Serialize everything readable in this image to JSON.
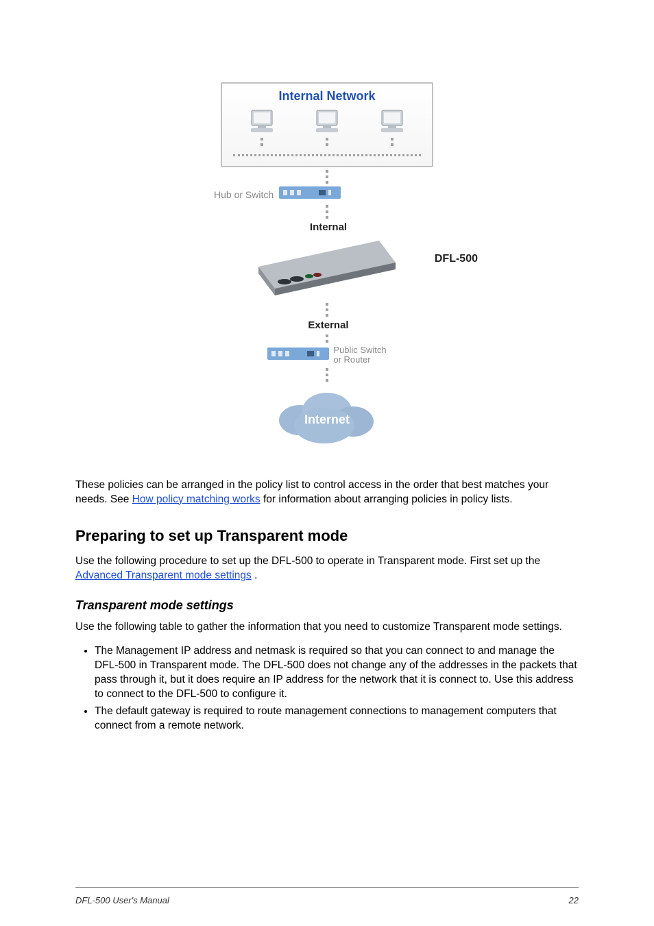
{
  "diagram": {
    "internal_network_title": "Internal Network",
    "hub_label": "Hub or Switch",
    "internal_port_label": "Internal",
    "device_model": "DFL-500",
    "external_port_label": "External",
    "public_switch_label_line1": "Public Switch",
    "public_switch_label_line2": "or Router",
    "cloud_label": "Internet"
  },
  "body": {
    "para1_part1": "These policies can be arranged in the policy list to control access in the order that best matches your needs. See ",
    "para1_link": "How policy matching works",
    "para1_part2": " for information about arranging policies in policy lists."
  },
  "section1": {
    "heading": "Preparing to set up Transparent mode",
    "para1_part1": "Use the following procedure to set up the DFL-500 to operate in Transparent mode. First set up the ",
    "para1_link": "Advanced Transparent mode settings",
    "para1_part2": ".",
    "subheading": "Transparent mode settings",
    "para2": "Use the following table to gather the information that you need to customize Transparent mode settings.",
    "bullets": [
      "The Management IP address and netmask is required so that you can connect to and manage the DFL-500 in Transparent mode. The DFL-500 does not change any of the addresses in the packets that pass through it, but it does require an IP address for the network that it is connect to. Use this address to connect to the DFL-500 to configure it.",
      "The default gateway is required to route management connections to management computers that connect from a remote network."
    ]
  },
  "footer": {
    "left": "DFL-500 User's Manual",
    "right": "22"
  }
}
